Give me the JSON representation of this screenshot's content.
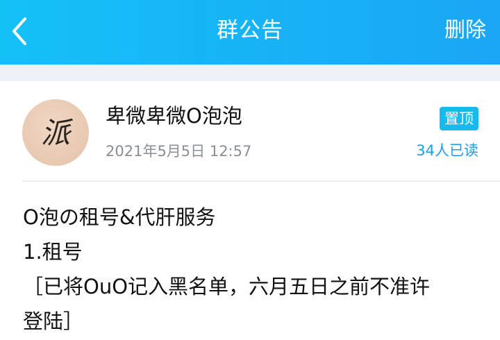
{
  "header": {
    "title": "群公告",
    "delete_label": "删除",
    "back_icon": "chevron-left-icon"
  },
  "colors": {
    "header_start": "#14c1f7",
    "header_end": "#1aa6f5",
    "badge_bg": "#18b9ef",
    "read_count": "#1a9ef0",
    "meta_text": "#8a8f96"
  },
  "post": {
    "author": "卑微卑微O泡泡",
    "timestamp": "2021年5月5日 12:57",
    "pinned_label": "置顶",
    "read_count_label": "34人已读",
    "avatar_glyph": "派",
    "content_lines": [
      "O泡の租号&代肝服务",
      "1.租号",
      "［已将OuO记入黑名单，六月五日之前不准许",
      "登陆］"
    ]
  }
}
